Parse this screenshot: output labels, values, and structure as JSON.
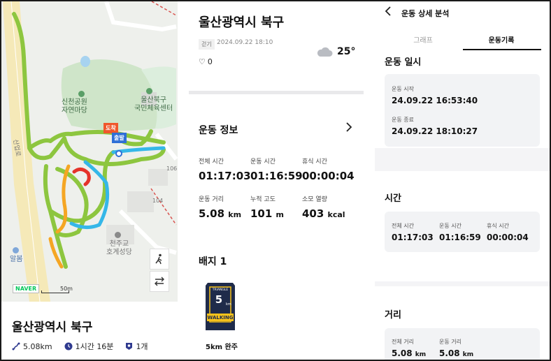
{
  "map": {
    "labels": {
      "park": "신천공원\n자연마당",
      "center": "울산북구\n국민체육센터",
      "church": "천주교\n호계성당",
      "road": "산업로",
      "num106": "106",
      "num104": "104",
      "albom": "알봄"
    },
    "marker_end": "도착",
    "marker_start": "출발",
    "naver": "NAVER",
    "scale": "50m"
  },
  "panel1": {
    "title": "울산광역시 북구",
    "distance": "5.08km",
    "duration": "1시간 16분",
    "badges": "1개"
  },
  "panel2": {
    "title": "울산광역시 북구",
    "activity_tag": "걷기",
    "datetime": "2024.09.22 18:10",
    "likes": "0",
    "temperature": "25°",
    "info_title": "운동 정보",
    "stats": [
      {
        "label": "전체 시간",
        "value": "01:17:03",
        "unit": ""
      },
      {
        "label": "운동 시간",
        "value": "01:16:59",
        "unit": ""
      },
      {
        "label": "휴식 시간",
        "value": "00:00:04",
        "unit": ""
      },
      {
        "label": "운동 거리",
        "value": "5.08",
        "unit": "km"
      },
      {
        "label": "누적 고도",
        "value": "101",
        "unit": "m"
      },
      {
        "label": "소모 열량",
        "value": "403",
        "unit": "kcal"
      }
    ],
    "badge_title": "배지 1",
    "badge": {
      "top": "TRIANGLE",
      "number": "5",
      "unit": "km",
      "word": "WALKING"
    },
    "badge_caption": "5km 완주"
  },
  "panel3": {
    "title": "운동 상세 분석",
    "tabs": [
      "그래프",
      "운동기록"
    ],
    "datetime_section": "운동 일시",
    "start_label": "운동 시작",
    "start_value": "24.09.22 16:53:40",
    "end_label": "운동 종료",
    "end_value": "24.09.22 18:10:27",
    "time_section": "시간",
    "time_cells": [
      {
        "label": "전체 시간",
        "value": "01:17:03"
      },
      {
        "label": "운동 시간",
        "value": "01:16:59"
      },
      {
        "label": "휴식 시간",
        "value": "00:00:04"
      }
    ],
    "distance_section": "거리",
    "distance_cells": [
      {
        "label": "전체 거리",
        "value": "5.08",
        "unit": "km"
      },
      {
        "label": "운동 거리",
        "value": "5.08",
        "unit": "km"
      }
    ]
  },
  "colors": {
    "route_green": "#8dc63f",
    "route_blue": "#35b7e8",
    "route_orange": "#f5a623",
    "route_red": "#e5332a",
    "marker_end": "#f0572b",
    "marker_start": "#2f6fd6",
    "naver_green": "#03c75a",
    "badge_navy": "#1f2b4a",
    "badge_yellow": "#f7c21b"
  },
  "icons": [
    "route-icon",
    "clock-icon",
    "badge-icon",
    "heart-icon",
    "cloud-icon",
    "back-chevron-icon",
    "chevron-right-icon",
    "walk-icon",
    "swap-icon"
  ]
}
